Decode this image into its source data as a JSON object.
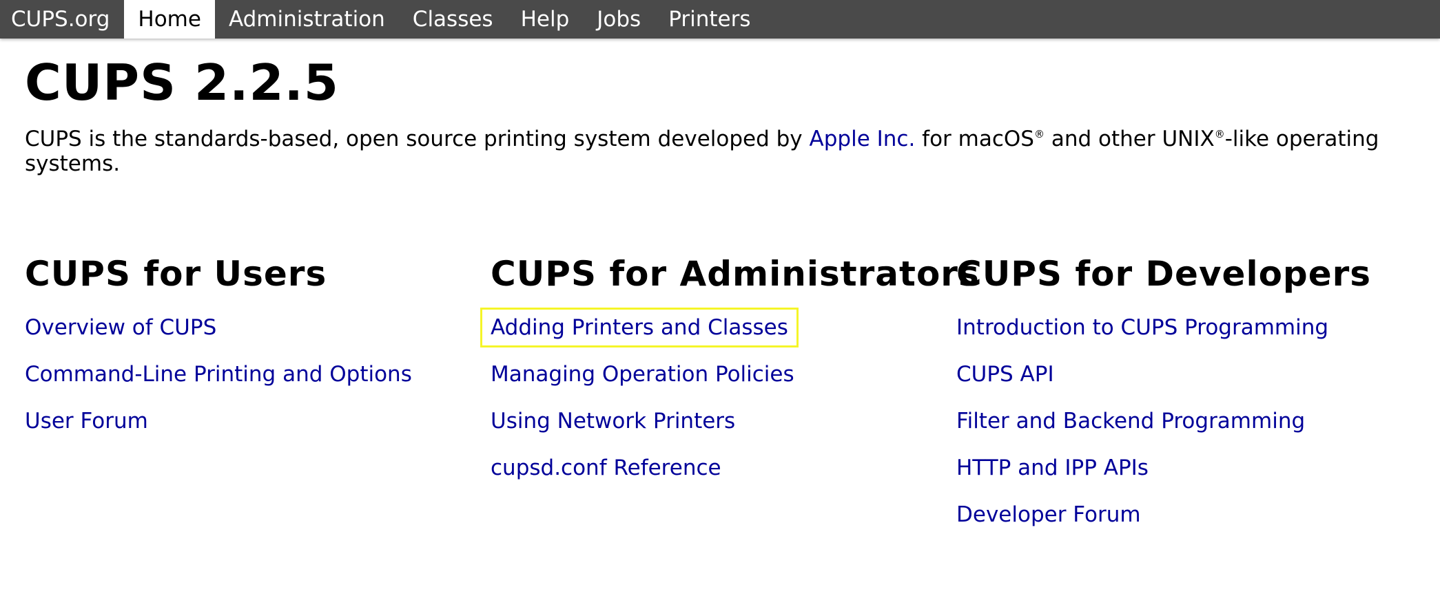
{
  "navbar": {
    "items": [
      {
        "label": "CUPS.org",
        "active": false
      },
      {
        "label": "Home",
        "active": true
      },
      {
        "label": "Administration",
        "active": false
      },
      {
        "label": "Classes",
        "active": false
      },
      {
        "label": "Help",
        "active": false
      },
      {
        "label": "Jobs",
        "active": false
      },
      {
        "label": "Printers",
        "active": false
      }
    ]
  },
  "page": {
    "title": "CUPS 2.2.5",
    "intro": {
      "before_link": "CUPS is the standards-based, open source printing system developed by ",
      "link": "Apple Inc.",
      "after_link_1": " for macOS",
      "reg1": "®",
      "after_link_2": " and other UNIX",
      "reg2": "®",
      "after_link_3": "-like operating systems."
    }
  },
  "columns": [
    {
      "heading": "CUPS for Users",
      "links": [
        "Overview of CUPS",
        "Command-Line Printing and Options",
        "User Forum"
      ]
    },
    {
      "heading": "CUPS for Administrators",
      "links": [
        "Adding Printers and Classes",
        "Managing Operation Policies",
        "Using Network Printers",
        "cupsd.conf Reference"
      ]
    },
    {
      "heading": "CUPS for Developers",
      "links": [
        "Introduction to CUPS Programming",
        "CUPS API",
        "Filter and Backend Programming",
        "HTTP and IPP APIs",
        "Developer Forum"
      ]
    }
  ],
  "colors": {
    "navbar_bg": "#4a4a4a",
    "link": "#000099",
    "highlight_outline": "#f5f528"
  }
}
